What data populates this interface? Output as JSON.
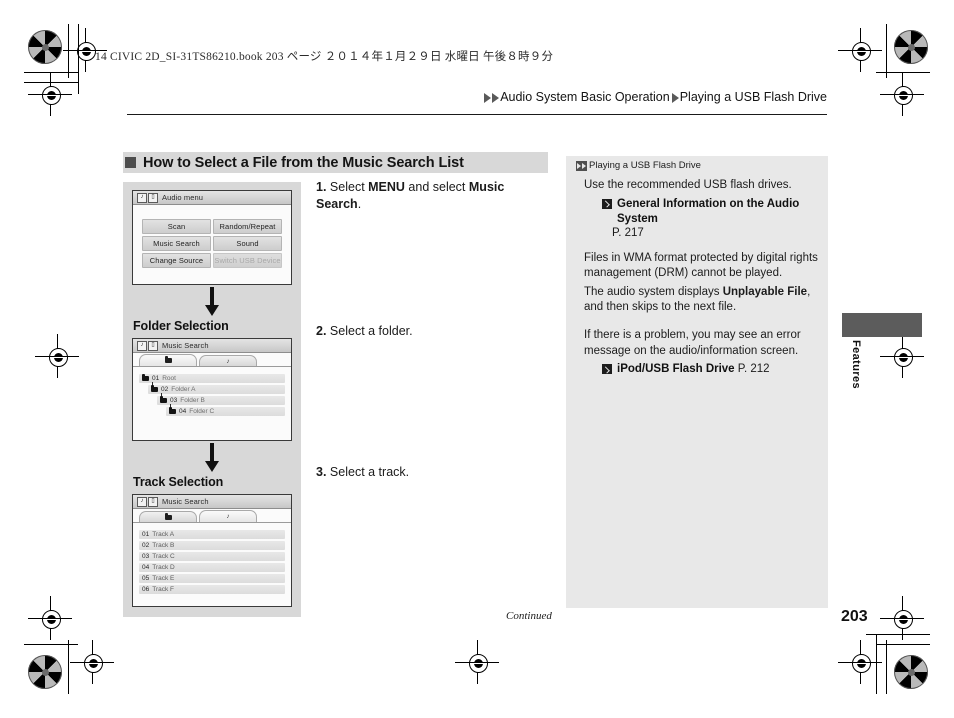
{
  "page": {
    "doc_slug": "14 CIVIC 2D_SI-31TS86210.book   203 ページ   ２０１４年１月２９日   水曜日   午後８時９分",
    "folio": "203",
    "continued": "Continued",
    "thumb_tab": "Features"
  },
  "breadcrumb": {
    "level1": "Audio System Basic Operation",
    "level2": "Playing a USB Flash Drive"
  },
  "section": {
    "title": "How to Select a File from the Music Search List"
  },
  "steps": [
    {
      "num": "1.",
      "pre": "Select ",
      "bold1": "MENU",
      "mid": " and select ",
      "bold2": "Music Search",
      "post": "."
    },
    {
      "num": "2.",
      "pre": "Select a folder.",
      "bold1": "",
      "mid": "",
      "bold2": "",
      "post": ""
    },
    {
      "num": "3.",
      "pre": "Select a track.",
      "bold1": "",
      "mid": "",
      "bold2": "",
      "post": ""
    }
  ],
  "flow": {
    "label_folder": "Folder Selection",
    "label_track": "Track Selection",
    "screens": {
      "audio_menu": {
        "title": "Audio menu",
        "buttons": [
          {
            "label": "Scan",
            "disabled": false
          },
          {
            "label": "Random/Repeat",
            "disabled": false
          },
          {
            "label": "Music Search",
            "disabled": false
          },
          {
            "label": "Sound",
            "disabled": false
          },
          {
            "label": "Change Source",
            "disabled": false
          },
          {
            "label": "Switch USB Device",
            "disabled": true
          }
        ]
      },
      "folder_search": {
        "title": "Music Search",
        "tabs": [
          {
            "icon": "folder-icon",
            "selected": true
          },
          {
            "icon": "music-note-icon",
            "selected": false
          }
        ],
        "rows": [
          {
            "num": "01",
            "name": "Root",
            "indent": 0
          },
          {
            "num": "02",
            "name": "Folder A",
            "indent": 1
          },
          {
            "num": "03",
            "name": "Folder B",
            "indent": 2
          },
          {
            "num": "04",
            "name": "Folder C",
            "indent": 3
          }
        ]
      },
      "track_search": {
        "title": "Music Search",
        "tabs": [
          {
            "icon": "folder-icon",
            "selected": false
          },
          {
            "icon": "music-note-icon",
            "selected": true
          }
        ],
        "rows": [
          {
            "num": "01",
            "name": "Track A"
          },
          {
            "num": "02",
            "name": "Track B"
          },
          {
            "num": "03",
            "name": "Track C"
          },
          {
            "num": "04",
            "name": "Track D"
          },
          {
            "num": "05",
            "name": "Track E"
          },
          {
            "num": "06",
            "name": "Track F"
          }
        ]
      }
    }
  },
  "note": {
    "heading": "Playing a USB Flash Drive",
    "p1": "Use the recommended USB flash drives.",
    "xref1_label": "General Information on the Audio System",
    "xref1_page": "P. 217",
    "p2a": "Files in WMA format protected by digital rights management (DRM) cannot be played.",
    "p2b_pre": "The audio system displays ",
    "p2b_bold": "Unplayable File",
    "p2b_post": ", and then skips to the next file.",
    "p3": "If there is a problem, you may see an error message on the audio/information screen.",
    "xref2_label": "iPod/USB Flash Drive",
    "xref2_page": "P. 212"
  }
}
